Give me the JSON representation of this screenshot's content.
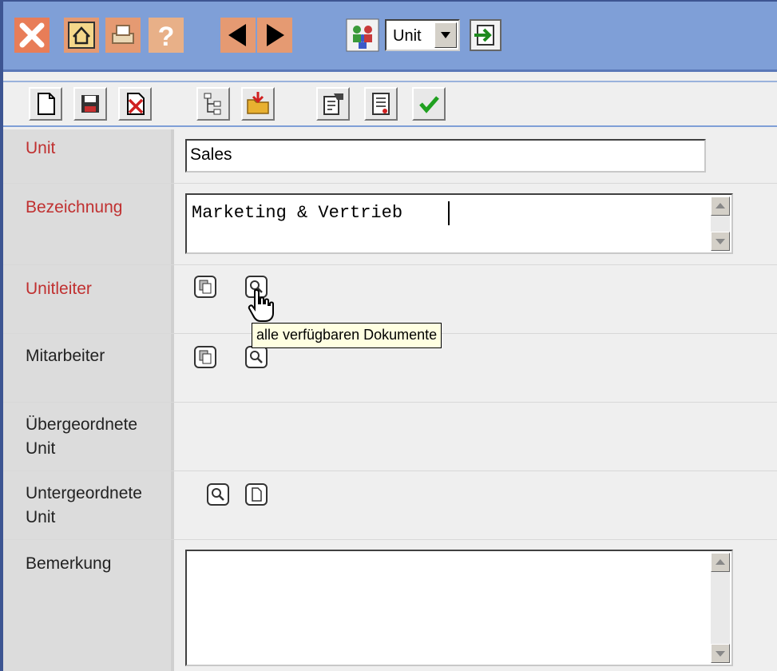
{
  "toolbar_top": {
    "unit_select": {
      "selected": "Unit"
    }
  },
  "form": {
    "unit": {
      "label": "Unit",
      "value": "Sales"
    },
    "bezeichnung": {
      "label": "Bezeichnung",
      "value": "Marketing & Vertrieb"
    },
    "unitleiter": {
      "label": "Unitleiter"
    },
    "mitarbeiter": {
      "label": "Mitarbeiter"
    },
    "uebergeordnete": {
      "label_line1": "Übergeordnete",
      "label_line2": "Unit"
    },
    "untergeordnete": {
      "label_line1": "Untergeordnete",
      "label_line2": "Unit"
    },
    "bemerkung": {
      "label": "Bemerkung",
      "value": ""
    }
  },
  "tooltip": {
    "text": "alle verfügbaren Dokumente"
  },
  "colors": {
    "toolbar": "#7f9fd7",
    "label_red": "#c03030",
    "frame": "#3d5592"
  }
}
